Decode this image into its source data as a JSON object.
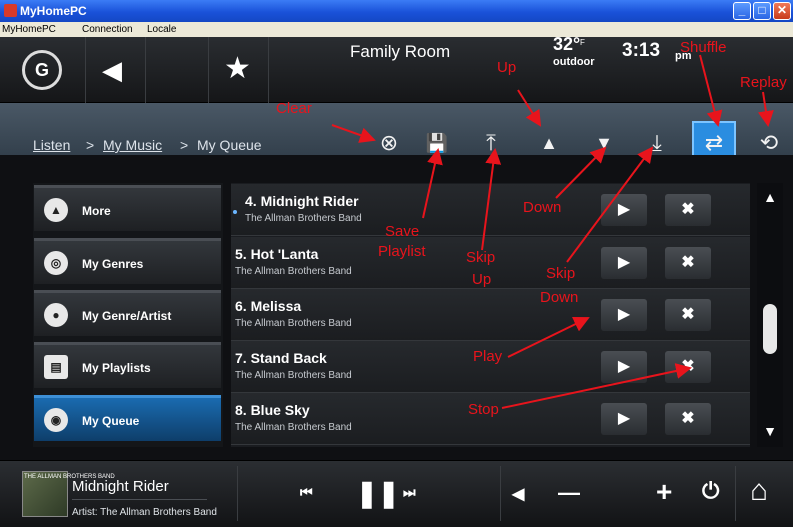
{
  "window": {
    "title": "MyHomePC",
    "minimize": "_",
    "maximize": "□",
    "close": "✕"
  },
  "menubar": {
    "items": [
      "MyHomePC",
      "Connection",
      "Locale"
    ]
  },
  "topbar": {
    "room": "Family Room",
    "temperature": "32°",
    "temperature_unit": "F",
    "temperature_label": "outdoor",
    "time": "3:13",
    "ampm": "pm",
    "back_icon": "◀",
    "favorite_icon": "★",
    "logo_icon": "G"
  },
  "breadcrumb": {
    "items": [
      "Listen",
      "My Music",
      "My Queue"
    ],
    "separator": ">"
  },
  "toolbar": {
    "clear": "⊗",
    "save": "💾",
    "skip_up": "⤒",
    "up": "▲",
    "down": "▼",
    "skip_down": "⤓",
    "shuffle": "⇄",
    "replay": "⟲"
  },
  "sidebar": {
    "items": [
      {
        "label": "More",
        "icon": "chevron-up-icon",
        "glyph": "▲"
      },
      {
        "label": "My Genres",
        "icon": "discs-icon",
        "glyph": "◎"
      },
      {
        "label": "My Genre/Artist",
        "icon": "people-icon",
        "glyph": "●"
      },
      {
        "label": "My Playlists",
        "icon": "document-icon",
        "glyph": "▤"
      },
      {
        "label": "My Queue",
        "icon": "disc-add-icon",
        "glyph": "◉"
      }
    ],
    "active": "My Queue"
  },
  "queue": [
    {
      "title": "4. Midnight Rider",
      "artist": "The Allman Brothers Band"
    },
    {
      "title": "5. Hot 'Lanta",
      "artist": "The Allman Brothers Band"
    },
    {
      "title": "6. Melissa",
      "artist": "The Allman Brothers Band"
    },
    {
      "title": "7. Stand Back",
      "artist": "The Allman Brothers Band"
    },
    {
      "title": "8. Blue Sky",
      "artist": "The Allman Brothers Band"
    }
  ],
  "row_buttons": {
    "play": "▶",
    "stop": "✖"
  },
  "scroll": {
    "up": "▲",
    "down": "▼"
  },
  "now_playing": {
    "title": "Midnight Rider",
    "artist": "Artist: The Allman Brothers Band",
    "album_text": "THE ALLMAN BROTHERS BAND"
  },
  "transport": {
    "prev": "⏮",
    "pause": "❚❚",
    "next": "⏭",
    "mute": "◀",
    "vol_down": "—",
    "vol_up": "+",
    "power": "⏻",
    "home": "⌂"
  },
  "annotations": {
    "clear": "Clear",
    "up": "Up",
    "shuffle": "Shuffle",
    "replay": "Replay",
    "save": "Save",
    "playlist": "Playlist",
    "skip": "Skip",
    "skip_up": "Up",
    "down": "Down",
    "skip_down_1": "Skip",
    "skip_down_2": "Down",
    "play": "Play",
    "stop": "Stop"
  },
  "colors": {
    "accent": "#2a8de0",
    "annotation": "#e8141c",
    "background": "#1a1c20"
  }
}
